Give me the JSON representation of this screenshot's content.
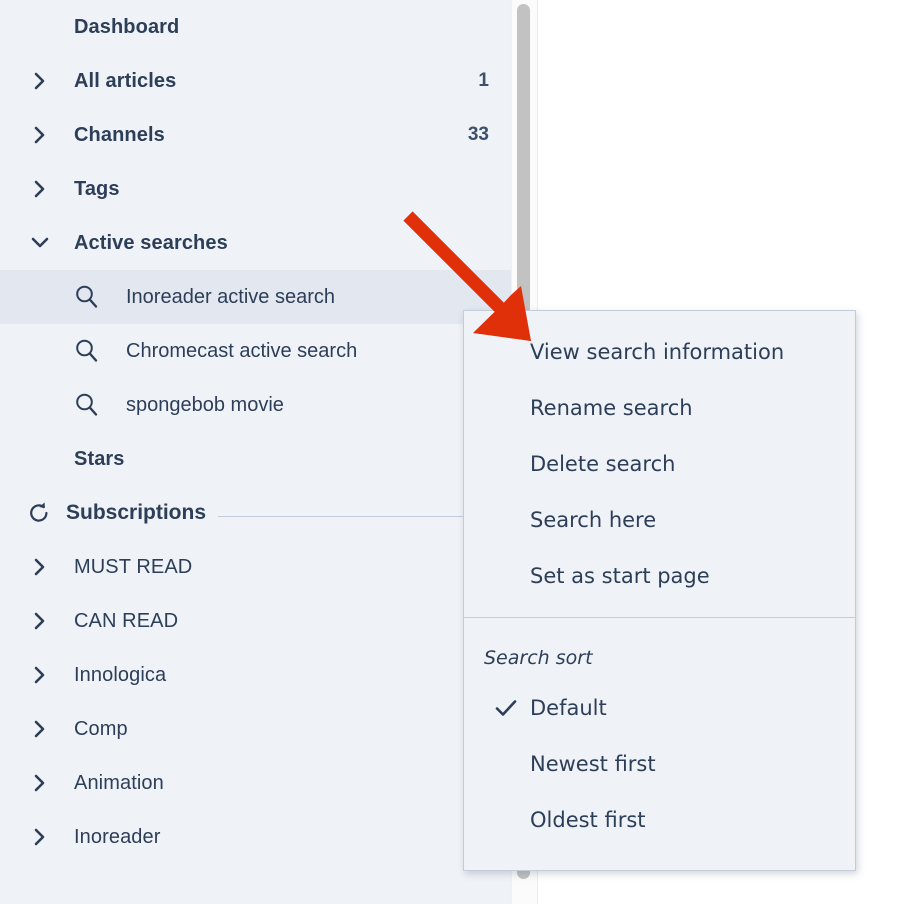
{
  "sidebar": {
    "items": [
      {
        "label": "Dashboard",
        "bold": true,
        "twisty": "none",
        "count": "",
        "type": "heading"
      },
      {
        "label": "All articles",
        "bold": true,
        "twisty": "chevron-right-icon",
        "count": "1",
        "type": "nav"
      },
      {
        "label": "Channels",
        "bold": true,
        "twisty": "chevron-right-icon",
        "count": "33",
        "type": "nav"
      },
      {
        "label": "Tags",
        "bold": true,
        "twisty": "chevron-right-icon",
        "count": "",
        "type": "nav"
      },
      {
        "label": "Active searches",
        "bold": true,
        "twisty": "chevron-down-icon",
        "count": "",
        "type": "nav"
      }
    ],
    "searches": [
      {
        "label": "Inoreader active search",
        "icon": "search-icon",
        "selected": true
      },
      {
        "label": "Chromecast active search",
        "icon": "search-icon",
        "selected": false
      },
      {
        "label": "spongebob movie",
        "icon": "search-icon",
        "selected": false
      }
    ],
    "stars_label": "Stars",
    "subscriptions": {
      "title": "Subscriptions",
      "icon": "refresh-icon",
      "folders": [
        {
          "label": "MUST READ",
          "twisty": "chevron-right-icon"
        },
        {
          "label": "CAN READ",
          "twisty": "chevron-right-icon"
        },
        {
          "label": "Innologica",
          "twisty": "chevron-right-icon"
        },
        {
          "label": "Comp",
          "twisty": "chevron-right-icon"
        },
        {
          "label": "Animation",
          "twisty": "chevron-right-icon"
        },
        {
          "label": "Inoreader",
          "twisty": "chevron-right-icon"
        }
      ]
    }
  },
  "context_menu": {
    "actions": [
      {
        "label": "View search information"
      },
      {
        "label": "Rename search"
      },
      {
        "label": "Delete search"
      },
      {
        "label": "Search here"
      },
      {
        "label": "Set as start page"
      }
    ],
    "sort_caption": "Search sort",
    "sort_options": [
      {
        "label": "Default",
        "checked": true
      },
      {
        "label": "Newest first",
        "checked": false
      },
      {
        "label": "Oldest first",
        "checked": false
      }
    ]
  },
  "annotation": {
    "arrow_color": "#e0300a",
    "arrow_name": "pointer-arrow"
  },
  "colors": {
    "sidebar_bg": "#eff2f7",
    "selected_bg": "#e2e7f0",
    "text": "#2d3e58",
    "menu_bg": "#eff2f7",
    "menu_border": "#c3ccda",
    "scroll_thumb": "#c2c2c2"
  }
}
